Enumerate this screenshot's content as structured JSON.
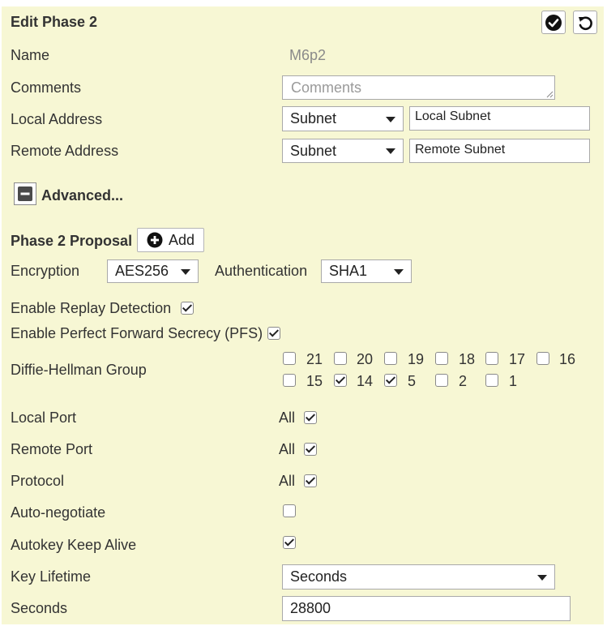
{
  "header": {
    "title": "Edit Phase 2",
    "confirm_icon": "check-circle-icon",
    "revert_icon": "undo-icon"
  },
  "fields": {
    "name_label": "Name",
    "name_value": "M6p2",
    "comments_label": "Comments",
    "comments_placeholder": "Comments",
    "local_address_label": "Local Address",
    "local_address_type": "Subnet",
    "local_address_value": "Local Subnet",
    "remote_address_label": "Remote Address",
    "remote_address_type": "Subnet",
    "remote_address_value": "Remote Subnet"
  },
  "advanced": {
    "label": "Advanced...",
    "toggle_icon": "minus-square-icon"
  },
  "proposal": {
    "title": "Phase 2 Proposal",
    "add_label": "Add",
    "add_icon": "plus-circle-icon",
    "encryption_label": "Encryption",
    "encryption_value": "AES256",
    "authentication_label": "Authentication",
    "authentication_value": "SHA1"
  },
  "options": {
    "replay_label": "Enable Replay Detection",
    "replay_checked": true,
    "pfs_label": "Enable Perfect Forward Secrecy (PFS)",
    "pfs_checked": true
  },
  "dh": {
    "label": "Diffie-Hellman Group",
    "groups": [
      {
        "value": "21",
        "checked": false
      },
      {
        "value": "20",
        "checked": false
      },
      {
        "value": "19",
        "checked": false
      },
      {
        "value": "18",
        "checked": false
      },
      {
        "value": "17",
        "checked": false
      },
      {
        "value": "16",
        "checked": false
      },
      {
        "value": "15",
        "checked": false
      },
      {
        "value": "14",
        "checked": true
      },
      {
        "value": "5",
        "checked": true
      },
      {
        "value": "2",
        "checked": false
      },
      {
        "value": "1",
        "checked": false
      }
    ]
  },
  "ports": {
    "local_port_label": "Local Port",
    "remote_port_label": "Remote Port",
    "protocol_label": "Protocol",
    "all_label": "All",
    "local_port_all": true,
    "remote_port_all": true,
    "protocol_all": true
  },
  "auto": {
    "negotiate_label": "Auto-negotiate",
    "negotiate_checked": false,
    "keepalive_label": "Autokey Keep Alive",
    "keepalive_checked": true
  },
  "lifetime": {
    "label": "Key Lifetime",
    "value": "Seconds",
    "seconds_label": "Seconds",
    "seconds_value": "28800"
  }
}
